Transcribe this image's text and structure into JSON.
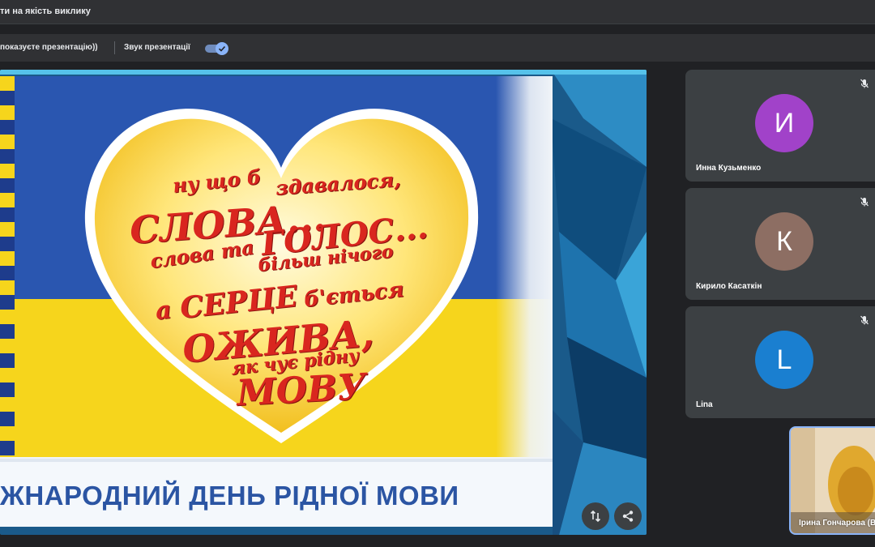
{
  "topbar": {
    "title": "ти на якість виклику"
  },
  "toolbar": {
    "presenting_text": "показуєте презентацію))",
    "sound_label": "Звук презентації",
    "sound_enabled": true
  },
  "slide": {
    "phrases": {
      "line1a": "ну що б",
      "line1b": "здавалося,",
      "line2": "слова...",
      "line3a": "слова та",
      "line3b": "голос...",
      "line4": "більш нічого",
      "line5a": "а",
      "line5b": "серце",
      "line5c": "б'ється",
      "line6": "ожива,",
      "line7": "як чує рідну",
      "line8": "мову"
    },
    "banner": "жнародний день рідної мови"
  },
  "stage_buttons": {
    "layout_icon": "swap-vertical-icon",
    "share_icon": "share-icon"
  },
  "participants": [
    {
      "initial": "И",
      "name": "Инна Кузьменко",
      "color": "#a142c9"
    },
    {
      "initial": "К",
      "name": "Кирило Касаткін",
      "color": "#8d6e63"
    },
    {
      "initial": "L",
      "name": "Lina",
      "color": "#1a7fd0"
    }
  ],
  "self_view": {
    "name": "Ірина Гончарова (В"
  }
}
